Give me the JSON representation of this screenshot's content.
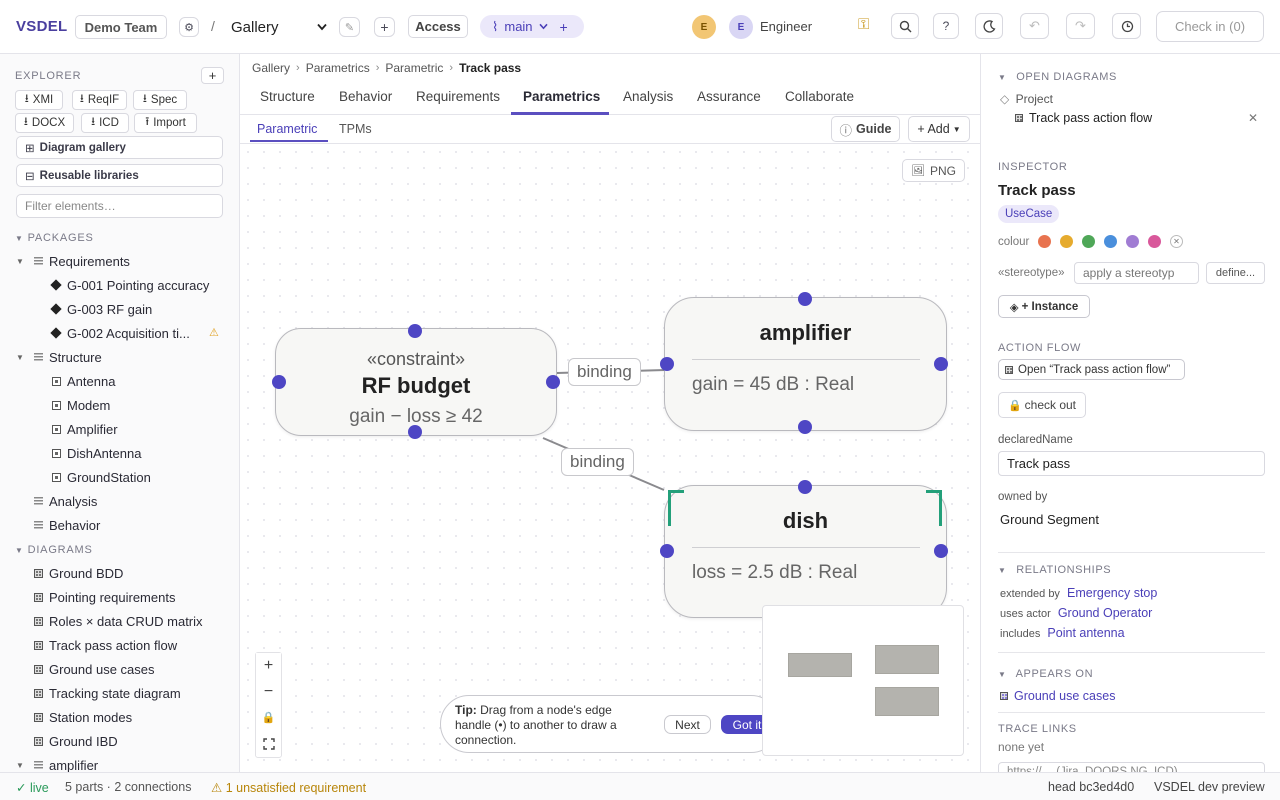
{
  "app": {
    "brand": "VSDEL",
    "team": "Demo Team",
    "path_sep": "/",
    "workspace": "Gallery",
    "access_label": "Access",
    "branch": "main",
    "user_initial_1": "E",
    "user_initial_2": "E",
    "user_name": "Engineer",
    "checkin_label": "Check in (0)"
  },
  "sidebar": {
    "explorer_label": "EXPLORER",
    "add_label": "+",
    "export_buttons": [
      {
        "icon": "download-icon",
        "label": "XMI"
      },
      {
        "icon": "download-icon",
        "label": "ReqIF"
      },
      {
        "icon": "download-icon",
        "label": "Spec"
      },
      {
        "icon": "download-icon",
        "label": "DOCX"
      },
      {
        "icon": "download-icon",
        "label": "ICD"
      },
      {
        "icon": "upload-icon",
        "label": "Import"
      }
    ],
    "diagram_gallery": "Diagram gallery",
    "reusable_libraries": "Reusable libraries",
    "filter_placeholder": "Filter elements…",
    "packages_label": "PACKAGES",
    "requirements_pkg": "Requirements",
    "requirements": [
      "G-001 Pointing accuracy",
      "G-003 RF gain",
      "G-002 Acquisition ti..."
    ],
    "structure_pkg": "Structure",
    "structure": [
      "Antenna",
      "Modem",
      "Amplifier",
      "DishAntenna",
      "GroundStation"
    ],
    "analysis_pkg": "Analysis",
    "behavior_pkg": "Behavior",
    "diagrams_label": "DIAGRAMS",
    "diagrams": [
      "Ground BDD",
      "Pointing requirements",
      "Roles × data CRUD matrix",
      "Track pass action flow",
      "Ground use cases",
      "Tracking state diagram",
      "Station modes",
      "Ground IBD"
    ],
    "last_partial": "amplifier"
  },
  "center": {
    "breadcrumb": [
      "Gallery",
      "Parametrics",
      "Parametric",
      "Track pass"
    ],
    "tabs": [
      "Structure",
      "Behavior",
      "Requirements",
      "Parametrics",
      "Analysis",
      "Assurance",
      "Collaborate"
    ],
    "active_tab": "Parametrics",
    "subtabs": [
      "Parametric",
      "TPMs"
    ],
    "guide_label": "Guide",
    "add_label": "+ Add",
    "png_label": "PNG",
    "nodes": {
      "rf_stereotype": "«constraint»",
      "rf_title": "RF budget",
      "rf_expr": "gain − loss ≥ 42",
      "amp_title": "amplifier",
      "amp_expr": "gain = 45 dB : Real",
      "dish_title": "dish",
      "dish_expr": "loss = 2.5 dB : Real"
    },
    "edge_label_1": "binding",
    "edge_label_2": "binding",
    "tip_bold": "Tip:",
    "tip_text": "Drag from a node's edge handle (•) to another to draw a connection.",
    "tip_next": "Next",
    "tip_gotit": "Got it"
  },
  "rpanel": {
    "open_diagrams_label": "OPEN DIAGRAMS",
    "project_label": "Project",
    "open_diagram": "Track pass action flow",
    "inspector_label": "INSPECTOR",
    "element_name": "Track pass",
    "element_type": "UseCase",
    "colour_label": "colour",
    "colours": [
      "#e8734f",
      "#e6ab2e",
      "#4fa758",
      "#4a8fdc",
      "#a07cd3",
      "#d9589b"
    ],
    "stereotype_label": "«stereotype»",
    "stereotype_placeholder": "apply a stereotyp",
    "define_label": "define...",
    "instance_label": "+ Instance",
    "action_flow_label": "ACTION FLOW",
    "open_action_flow": "Open “Track pass action flow”",
    "checkout_label": "check out",
    "declared_name_label": "declaredName",
    "declared_name_value": "Track pass",
    "owned_by_label": "owned by",
    "owned_by_value": "Ground Segment",
    "relationships_label": "RELATIONSHIPS",
    "relationships": [
      {
        "kind": "extended by",
        "target": "Emergency stop"
      },
      {
        "kind": "uses actor",
        "target": "Ground Operator"
      },
      {
        "kind": "includes",
        "target": "Point antenna"
      }
    ],
    "appears_on_label": "APPEARS ON",
    "appears_on": "Ground use cases",
    "trace_links_label": "TRACE LINKS",
    "trace_none": "none yet",
    "trace_placeholder": "https://… (Jira, DOORS NG, ICD)"
  },
  "status": {
    "live": "live",
    "counts": "5 parts · 2 connections",
    "warning": "1 unsatisfied requirement",
    "head": "head bc3ed4d0",
    "preview": "VSDEL dev preview"
  }
}
